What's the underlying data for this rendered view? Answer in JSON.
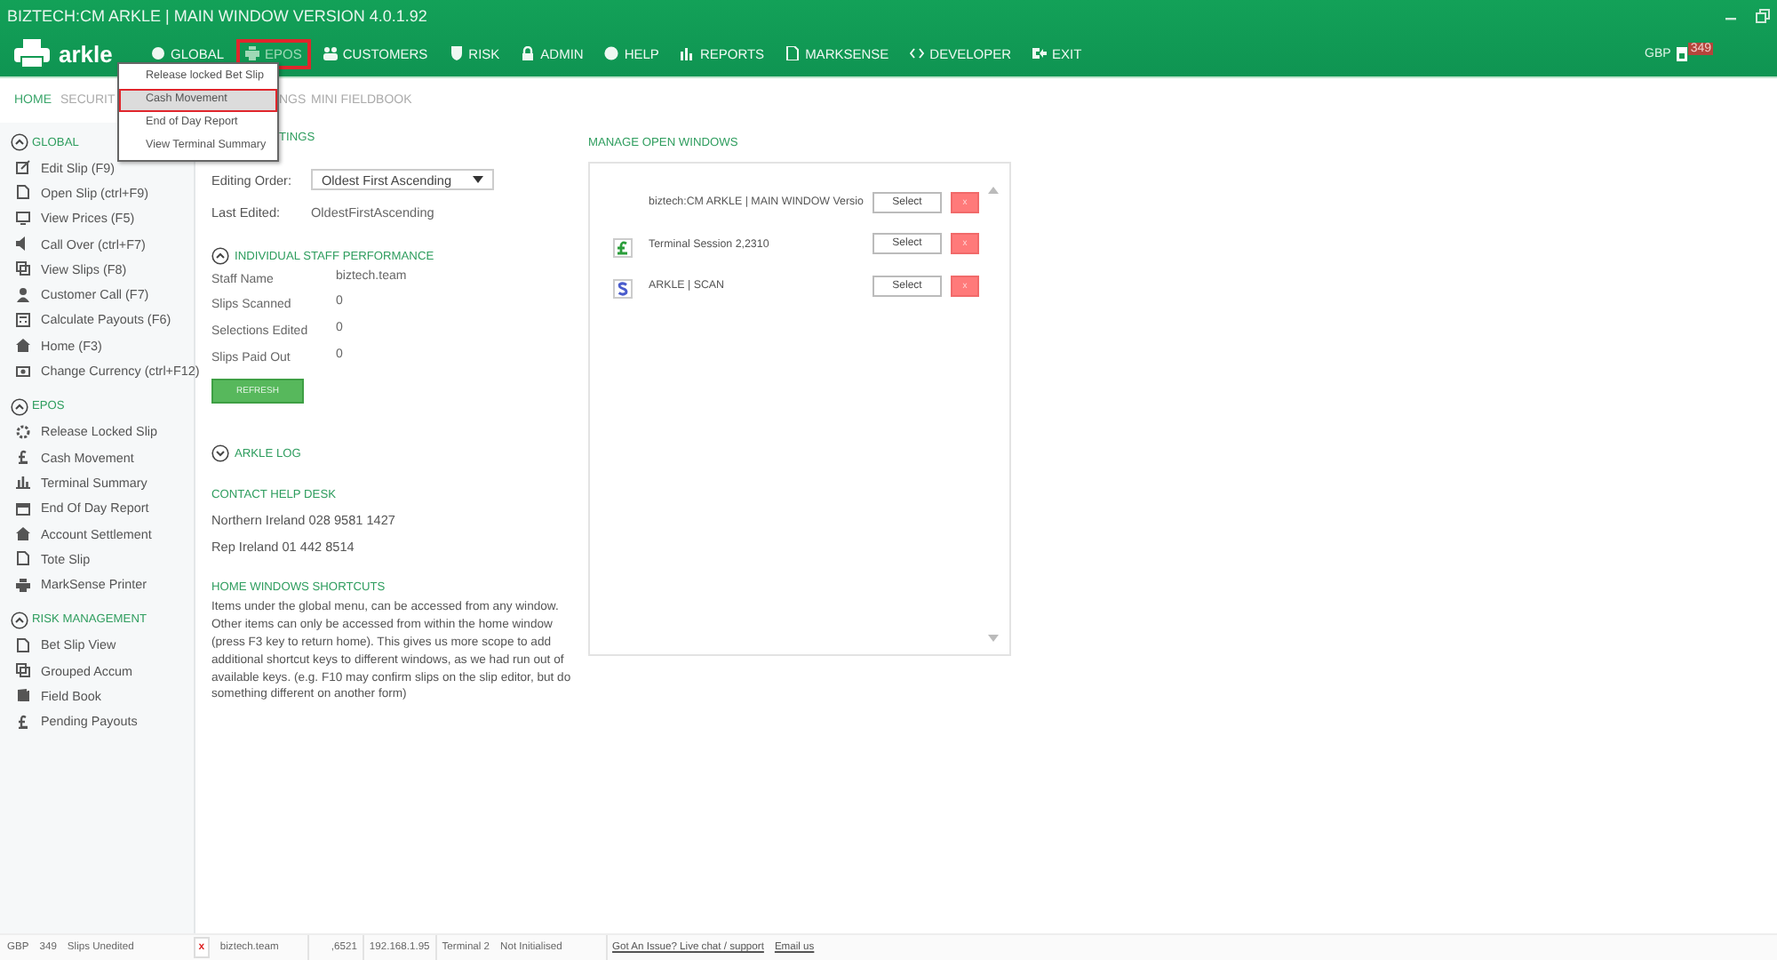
{
  "window": {
    "title": "BIZTECH:CM ARKLE | MAIN WINDOW VERSION 4.0.1.92"
  },
  "logo": {
    "text": "arkle"
  },
  "nav": [
    {
      "label": "GLOBAL",
      "selected": false
    },
    {
      "label": "EPOS",
      "selected": true
    },
    {
      "label": "CUSTOMERS",
      "selected": false
    },
    {
      "label": "RISK",
      "selected": false
    },
    {
      "label": "ADMIN",
      "selected": false
    },
    {
      "label": "HELP",
      "selected": false
    },
    {
      "label": "REPORTS",
      "selected": false
    },
    {
      "label": "MARKSENSE",
      "selected": false
    },
    {
      "label": "DEVELOPER",
      "selected": false
    },
    {
      "label": "EXIT",
      "selected": false
    }
  ],
  "currency": {
    "code": "GBP",
    "badge": "349"
  },
  "dropdown": [
    {
      "label": "Release locked Bet Slip",
      "selected": false
    },
    {
      "label": "Cash Movement",
      "selected": true
    },
    {
      "label": "End of Day Report",
      "selected": false
    },
    {
      "label": "View Terminal Summary",
      "selected": false
    }
  ],
  "tabs": [
    {
      "label": "HOME",
      "selected": true
    },
    {
      "label": "SECURIT",
      "selected": false
    },
    {
      "label": "NGS",
      "selected": false
    },
    {
      "label": "MINI FIELDBOOK",
      "selected": false
    }
  ],
  "sidebar": [
    {
      "title": "GLOBAL",
      "expanded": true,
      "items": [
        "Edit Slip (F9)",
        "Open Slip (ctrl+F9)",
        "View Prices (F5)",
        "Call Over (ctrl+F7)",
        "View Slips (F8)",
        "Customer Call (F7)",
        "Calculate Payouts (F6)",
        "Home (F3)",
        "Change Currency (ctrl+F12)"
      ]
    },
    {
      "title": "EPOS",
      "expanded": true,
      "items": [
        "Release Locked Slip",
        "Cash Movement",
        "Terminal Summary",
        "End Of Day Report",
        "Account Settlement",
        "Tote Slip",
        "MarkSense Printer"
      ]
    },
    {
      "title": "RISK MANAGEMENT",
      "expanded": true,
      "items": [
        "Bet Slip View",
        "Grouped Accum",
        "Field Book",
        "Pending Payouts"
      ]
    }
  ],
  "settings": {
    "heading": "TINGS",
    "fields": [
      {
        "label": "Editing Order:",
        "value": "Oldest First Ascending",
        "kind": "select"
      },
      {
        "label": "Last Edited:",
        "value": "OldestFirstAscending",
        "kind": "text"
      }
    ]
  },
  "staff": {
    "heading": "INDIVIDUAL STAFF PERFORMANCE",
    "expanded": true,
    "rows": [
      {
        "label": "Staff Name",
        "value": "biztech.team"
      },
      {
        "label": "Slips Scanned",
        "value": "0"
      },
      {
        "label": "Selections Edited",
        "value": "0"
      },
      {
        "label": "Slips Paid Out",
        "value": "0"
      }
    ],
    "button": "REFRESH"
  },
  "log": {
    "heading": "ARKLE LOG",
    "expanded": false
  },
  "help": {
    "heading": "CONTACT HELP DESK",
    "lines": [
      "Northern Ireland 028 9581 1427",
      "Rep Ireland 01 442 8514"
    ]
  },
  "shortcuts": {
    "heading": "HOME WINDOWS SHORTCUTS",
    "text": "Items under the global menu, can be accessed from any window. Other items can only be accessed from within the home window (press F3 key to return home). This gives us more scope to add additional shortcut keys to different windows, as we had run out of available keys. (e.g. F10 may confirm slips on the slip editor, but do something different on another form)"
  },
  "open_windows": {
    "heading": "MANAGE OPEN WINDOWS",
    "rows": [
      {
        "title": "biztech:CM ARKLE | MAIN WINDOW Versio",
        "kind": "none",
        "select": "Select",
        "close": "x"
      },
      {
        "title": "Terminal Session 2,2310",
        "kind": "pound",
        "select": "Select",
        "close": "x"
      },
      {
        "title": "ARKLE | SCAN",
        "kind": "scan",
        "select": "Select",
        "close": "x"
      }
    ]
  },
  "status_bar": {
    "currency": "GBP",
    "count": "349",
    "label": "Slips Unedited",
    "close": "x",
    "user": "biztech.team",
    "port": ",6521",
    "ip": "192.168.1.95",
    "terminal": "Terminal 2",
    "state": "Not Initialised",
    "links": [
      "Got An Issue? Live chat / support",
      "Email us"
    ]
  }
}
